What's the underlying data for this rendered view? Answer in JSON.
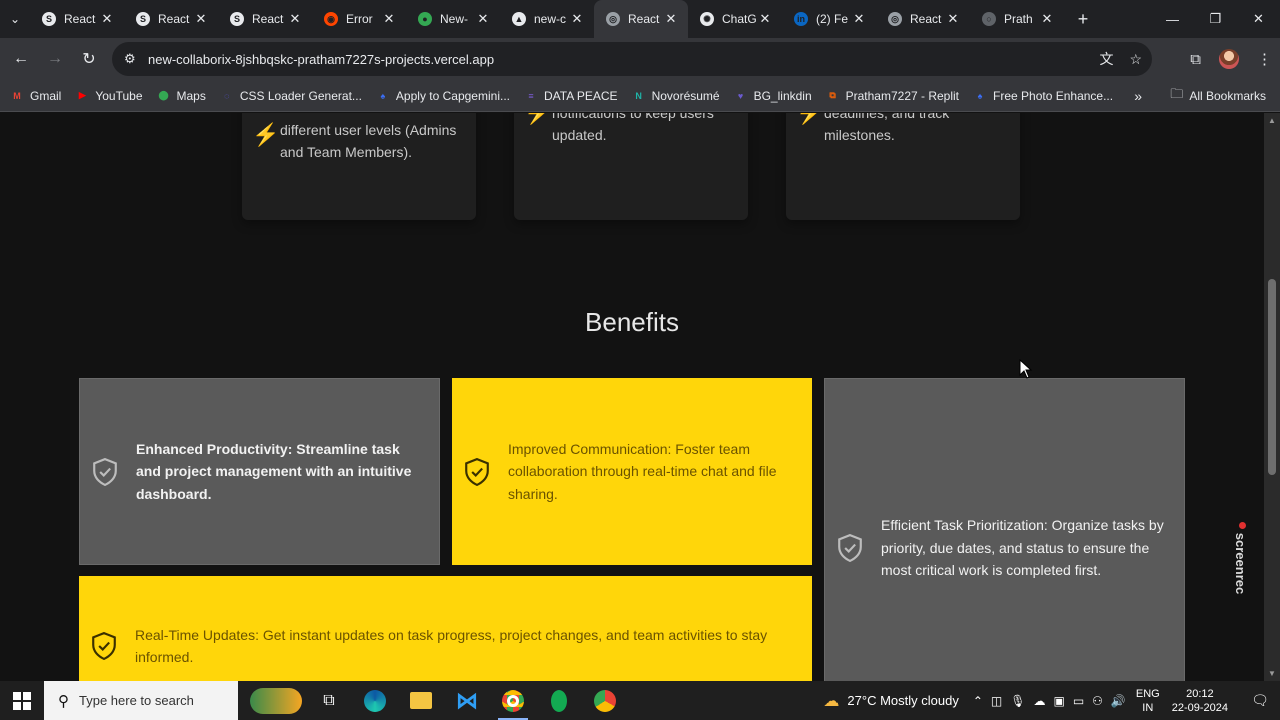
{
  "browser": {
    "tabs": [
      {
        "title": "React",
        "fav_color": "#e8eaed",
        "fav_glyph": "S"
      },
      {
        "title": "React",
        "fav_color": "#e8eaed",
        "fav_glyph": "S"
      },
      {
        "title": "React",
        "fav_color": "#e8eaed",
        "fav_glyph": "S"
      },
      {
        "title": "Error",
        "fav_color": "#ff4500",
        "fav_glyph": "◉"
      },
      {
        "title": "New-",
        "fav_color": "#34a853",
        "fav_glyph": "●"
      },
      {
        "title": "new-c",
        "fav_color": "#e8eaed",
        "fav_glyph": "▲"
      },
      {
        "title": "React",
        "fav_color": "#9aa0a6",
        "fav_glyph": "◎"
      },
      {
        "title": "ChatG",
        "fav_color": "#e8eaed",
        "fav_glyph": "✺"
      },
      {
        "title": "(2) Fe",
        "fav_color": "#0a66c2",
        "fav_glyph": "in"
      },
      {
        "title": "React",
        "fav_color": "#9aa0a6",
        "fav_glyph": "◎"
      },
      {
        "title": "Prath",
        "fav_color": "#5f6368",
        "fav_glyph": "○"
      }
    ],
    "active_tab_index": 6,
    "new_tab_glyph": "+",
    "url": "new-collaborix-8jshbqskc-pratham7227s-projects.vercel.app",
    "bookmarks": [
      {
        "label": "Gmail",
        "color": "#ea4335",
        "glyph": "M"
      },
      {
        "label": "YouTube",
        "color": "#ff0000",
        "glyph": "▶"
      },
      {
        "label": "Maps",
        "color": "#34a853",
        "glyph": "⬤"
      },
      {
        "label": "CSS Loader Generat...",
        "color": "#5b5bff",
        "glyph": "◌"
      },
      {
        "label": "Apply to Capgemini...",
        "color": "#3b6ef5",
        "glyph": "♠"
      },
      {
        "label": "DATA PEACE",
        "color": "#7b5cd6",
        "glyph": "≡"
      },
      {
        "label": "Novorésumé",
        "color": "#1fb5a8",
        "glyph": "N"
      },
      {
        "label": "BG_linkdin",
        "color": "#6a5acd",
        "glyph": "♥"
      },
      {
        "label": "Pratham7227 - Replit",
        "color": "#f26207",
        "glyph": "⧉"
      },
      {
        "label": "Free Photo Enhance...",
        "color": "#3b6ef5",
        "glyph": "♠"
      }
    ],
    "more_bookmarks_glyph": "»",
    "all_bookmarks": "All Bookmarks"
  },
  "features": [
    {
      "text": "Role-based access control for different user levels (Admins and Team Members).",
      "bolt": "⚡"
    },
    {
      "text": "Displays recent activities and notifications to keep users updated.",
      "bolt": "⚡"
    },
    {
      "text": "Assign team members, set deadlines, and track milestones.",
      "bolt": "⚡"
    }
  ],
  "benefits_title": "Benefits",
  "benefits": [
    {
      "text": "Enhanced Productivity: Streamline task and project management with an intuitive dashboard.",
      "style": "gray"
    },
    {
      "text": "Improved Communication: Foster team collaboration through real-time chat and file sharing.",
      "style": "yellow"
    },
    {
      "text": "Efficient Task Prioritization: Organize tasks by priority, due dates, and status to ensure the most critical work is completed first.",
      "style": "gray"
    },
    {
      "text": "Real-Time Updates: Get instant updates on task progress, project changes, and team activities to stay informed.",
      "style": "yellow"
    }
  ],
  "overlay": {
    "screenrec_label": "screenrec"
  },
  "taskbar": {
    "search_placeholder": "Type here to search",
    "weather": "27°C  Mostly cloudy",
    "lang_top": "ENG",
    "lang_bottom": "IN",
    "time": "20:12",
    "date": "22-09-2024"
  }
}
